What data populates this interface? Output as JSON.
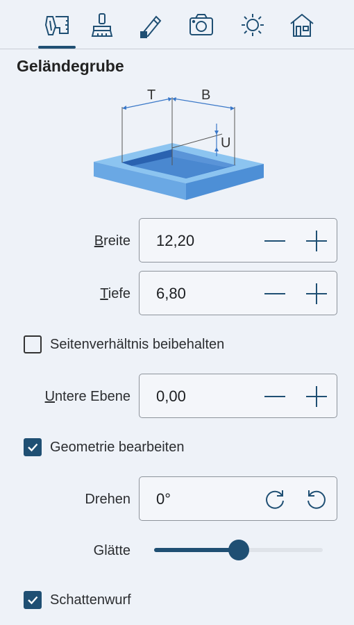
{
  "tabs": [
    {
      "name": "terrain-tool-icon",
      "active": true
    },
    {
      "name": "paint-brush-icon",
      "active": false
    },
    {
      "name": "pencil-icon",
      "active": false
    },
    {
      "name": "camera-icon",
      "active": false
    },
    {
      "name": "sun-icon",
      "active": false
    },
    {
      "name": "house-icon",
      "active": false
    }
  ],
  "section": {
    "title": "Geländegrube"
  },
  "diagram": {
    "label_t": "T",
    "label_b": "B",
    "label_u": "U"
  },
  "breite": {
    "label_key": "B",
    "label_rest": "reite",
    "value": "12,20"
  },
  "tiefe": {
    "label_key": "T",
    "label_rest": "iefe",
    "value": "6,80"
  },
  "aspect": {
    "label": "Seitenverhältnis beibehalten",
    "checked": false
  },
  "untere": {
    "label_key": "U",
    "label_rest": "ntere Ebene",
    "value": "0,00"
  },
  "geometry": {
    "label": "Geometrie bearbeiten",
    "checked": true
  },
  "drehen": {
    "label": "Drehen",
    "value": "0°"
  },
  "glaette": {
    "label": "Glätte",
    "value": 0.5
  },
  "shadow": {
    "label": "Schattenwurf",
    "checked": true
  },
  "colors": {
    "accent": "#1f4f73",
    "icon": "#1f4f73",
    "pool_light": "#7fb8ea",
    "pool_dark": "#3a78c8"
  }
}
